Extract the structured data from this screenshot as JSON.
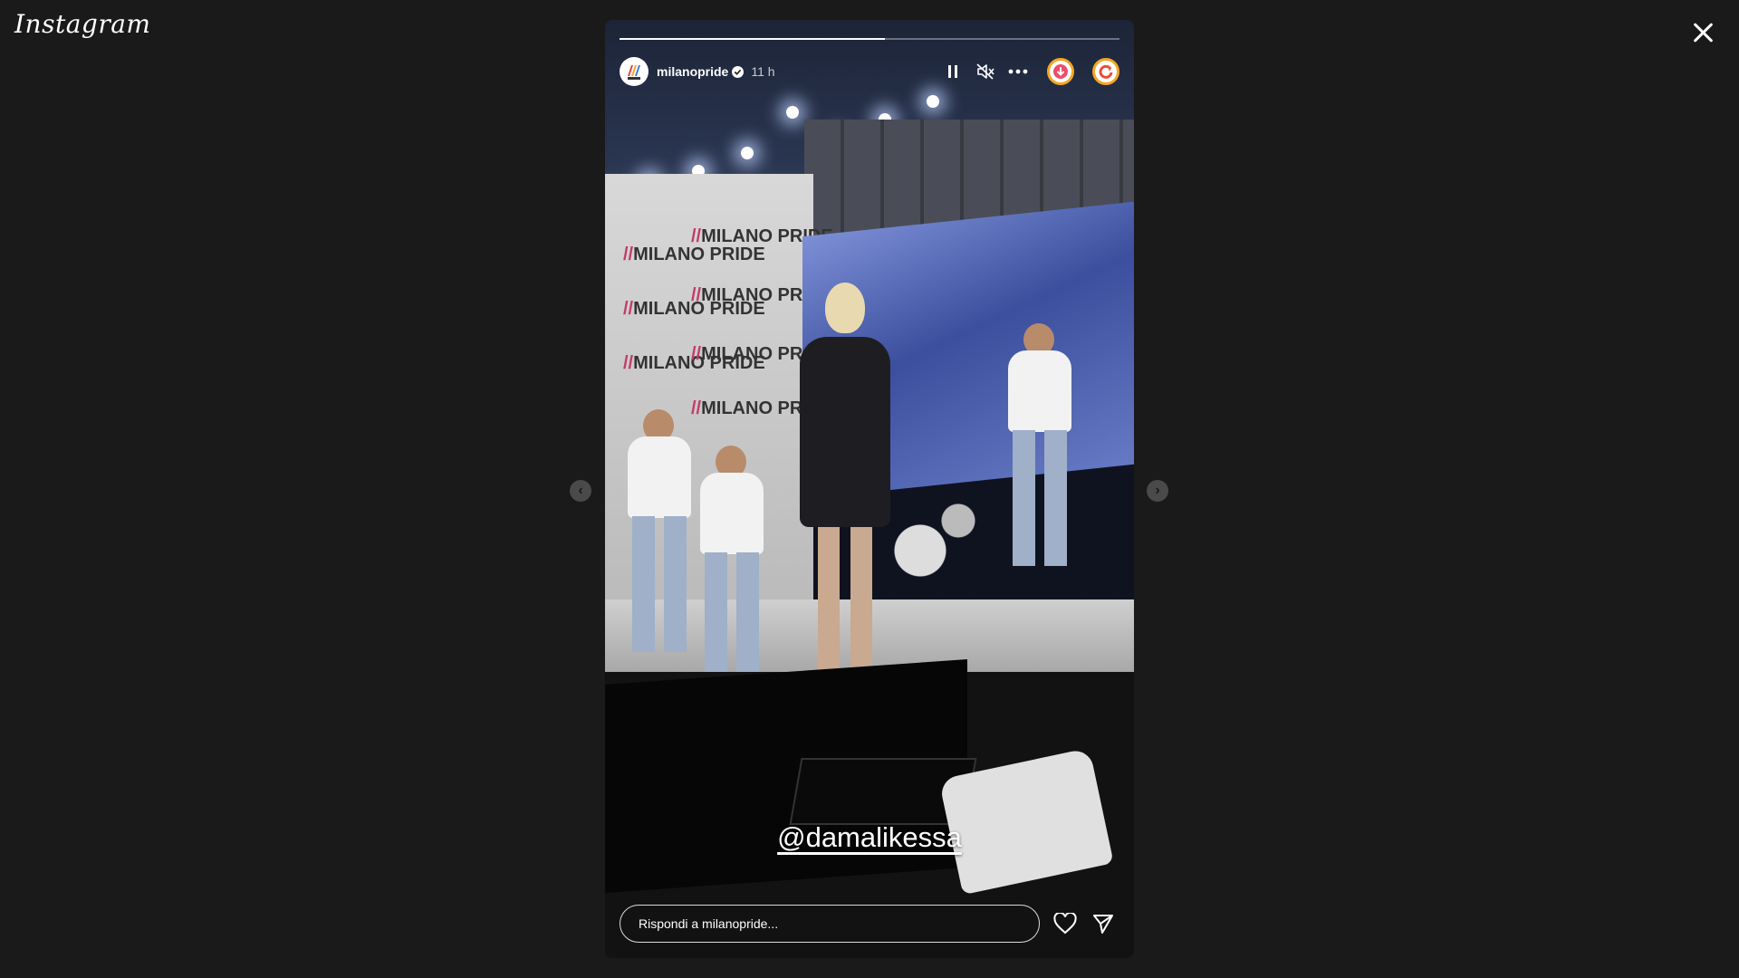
{
  "app": {
    "logo_text": "Instagram"
  },
  "story": {
    "username": "milanopride",
    "time_ago": "11 h",
    "progress": 0.53,
    "mention": "@damalikessa",
    "reply_placeholder": "Rispondi a milanopride...",
    "backdrop_tag": "MILANO PRIDE"
  },
  "icons": {
    "close": "close-icon",
    "prev": "chevron-left-icon",
    "next": "chevron-right-icon",
    "pause": "pause-icon",
    "mute": "mute-icon",
    "more": "more-icon",
    "heart": "heart-icon",
    "share": "send-icon"
  },
  "colors": {
    "background": "#1a1a1a",
    "ext_icon_1": "#f5a623",
    "ext_icon_2": "#e94e3a"
  }
}
